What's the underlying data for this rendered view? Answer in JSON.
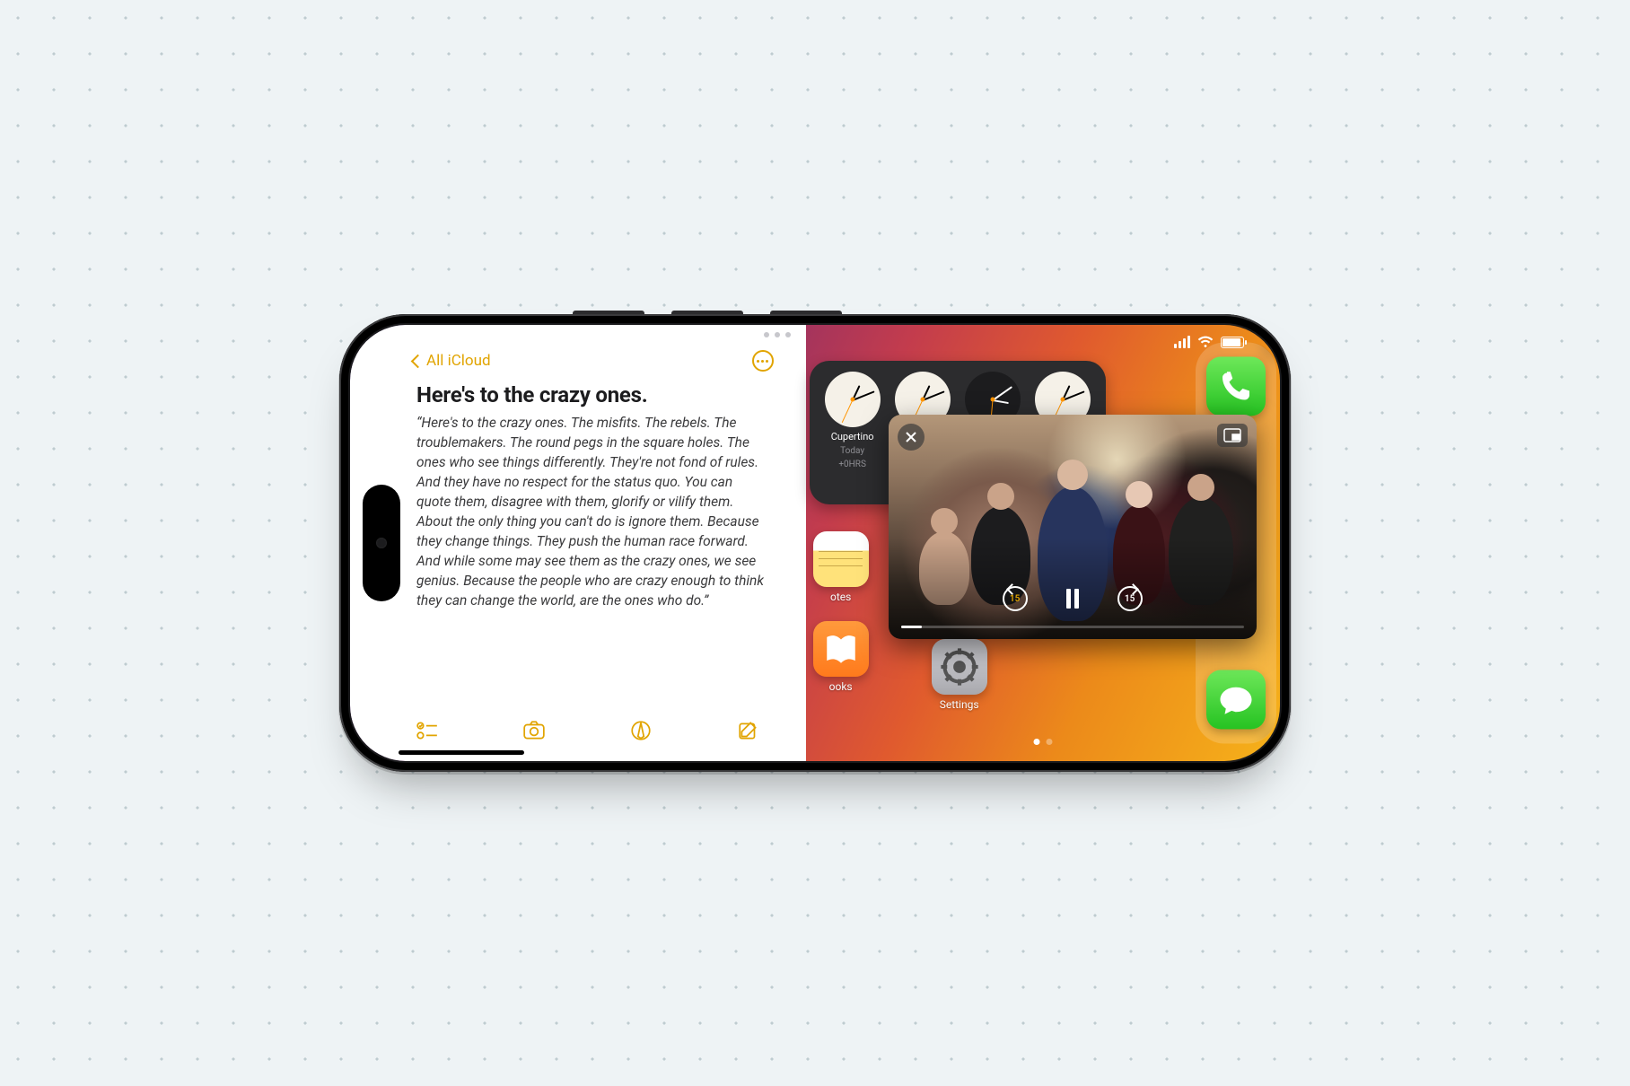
{
  "notes": {
    "back_label": "All iCloud",
    "title": "Here's to the crazy ones.",
    "body": "“Here's to the crazy ones. The misfits. The rebels. The troublemakers. The round pegs in the square holes. The ones who see things differently. They're not fond of rules. And they have no respect for the status quo. You can quote them, disagree with them, glorify or vilify them. About the only thing you can't do is ignore them. Because they change things. They push the human race forward. And while some may see them as the crazy ones, we see genius. Because the people who are crazy enough to think they can change the world, are the ones who do.”",
    "toolbar": {
      "checklist": "checklist",
      "camera": "camera",
      "markup": "markup",
      "compose": "compose"
    },
    "accent": "#e1a400"
  },
  "status": {
    "signal_bars": 4,
    "wifi": true,
    "battery_pct": 90
  },
  "clock_widget": {
    "cities": [
      {
        "name": "Cupertino",
        "day": "Today",
        "offset": "+0HRS"
      },
      {
        "name": "",
        "day": "",
        "offset": ""
      },
      {
        "name": "",
        "day": "",
        "offset": ""
      },
      {
        "name": "",
        "day": "",
        "offset": ""
      }
    ]
  },
  "home": {
    "apps_left": [
      {
        "label": "otes",
        "icon": "notes"
      },
      {
        "label": "ooks",
        "icon": "books"
      }
    ],
    "apps_mid": [
      {
        "label": "Settings",
        "icon": "settings"
      }
    ],
    "page_index": 0,
    "page_count": 2
  },
  "dock": {
    "apps": [
      {
        "label": "Phone",
        "icon": "phone"
      },
      {
        "label": "Messages",
        "icon": "messages"
      }
    ]
  },
  "pip": {
    "skip_seconds": "15",
    "state": "paused",
    "progress_pct": 6
  }
}
